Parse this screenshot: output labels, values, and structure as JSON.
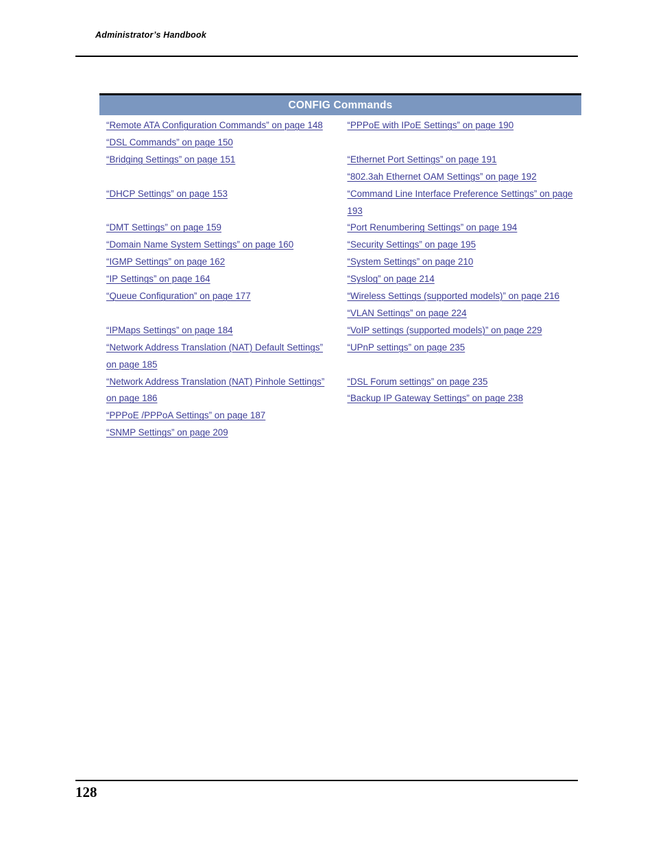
{
  "header": {
    "running_head": "Administrator’s Handbook"
  },
  "banner": {
    "title": "CONFIG Commands",
    "background_color": "#7b97c0",
    "text_color": "#ffffff"
  },
  "link_color": "#3c3c96",
  "toc": {
    "left_column": [
      {
        "type": "link",
        "text": "“Remote ATA Configuration Commands” on page 148"
      },
      {
        "type": "link",
        "text": "“DSL Commands” on page 150"
      },
      {
        "type": "link",
        "text": "“Bridging Settings” on page 151"
      },
      {
        "type": "spacer",
        "text": ""
      },
      {
        "type": "link",
        "text": "“DHCP Settings” on page 153"
      },
      {
        "type": "spacer",
        "text": ""
      },
      {
        "type": "link",
        "text": "“DMT Settings” on page 159"
      },
      {
        "type": "link",
        "text": "“Domain Name System Settings” on page 160"
      },
      {
        "type": "link",
        "text": "“IGMP Settings” on page 162"
      },
      {
        "type": "link",
        "text": "“IP Settings” on page 164"
      },
      {
        "type": "link",
        "text": "“Queue Configuration” on page 177"
      },
      {
        "type": "spacer",
        "text": ""
      },
      {
        "type": "link",
        "text": "“IPMaps Settings” on page 184"
      },
      {
        "type": "link",
        "text": "“Network Address Translation (NAT) Default Settings” on page 185"
      },
      {
        "type": "link",
        "text": "“Network Address Translation (NAT) Pinhole Settings” on page 186"
      },
      {
        "type": "link",
        "text": "“PPPoE /PPPoA Settings” on page 187"
      },
      {
        "type": "link",
        "text": "“SNMP Settings” on page 209"
      }
    ],
    "right_column": [
      {
        "type": "link",
        "text": "“PPPoE with IPoE Settings” on page 190"
      },
      {
        "type": "spacer",
        "text": ""
      },
      {
        "type": "link",
        "text": "“Ethernet Port Settings” on page 191"
      },
      {
        "type": "link",
        "text": "“802.3ah Ethernet OAM Settings” on page 192"
      },
      {
        "type": "link",
        "text": "“Command Line Interface Preference Settings” on page 193"
      },
      {
        "type": "link",
        "text": "“Port Renumbering Settings” on page 194"
      },
      {
        "type": "link",
        "text": "“Security Settings” on page 195"
      },
      {
        "type": "link",
        "text": "“System Settings” on page 210"
      },
      {
        "type": "link",
        "text": "“Syslog” on page 214"
      },
      {
        "type": "link",
        "text": "“Wireless Settings (supported models)” on page 216"
      },
      {
        "type": "link",
        "text": "“VLAN Settings” on page 224"
      },
      {
        "type": "link",
        "text": "“VoIP settings (supported models)” on page 229"
      },
      {
        "type": "link",
        "text": "“UPnP settings” on page 235"
      },
      {
        "type": "spacer",
        "text": ""
      },
      {
        "type": "link",
        "text": "“DSL Forum settings” on page 235"
      },
      {
        "type": "link",
        "text": "“Backup IP Gateway Settings” on page 238"
      }
    ]
  },
  "footer": {
    "page_number": "128"
  }
}
